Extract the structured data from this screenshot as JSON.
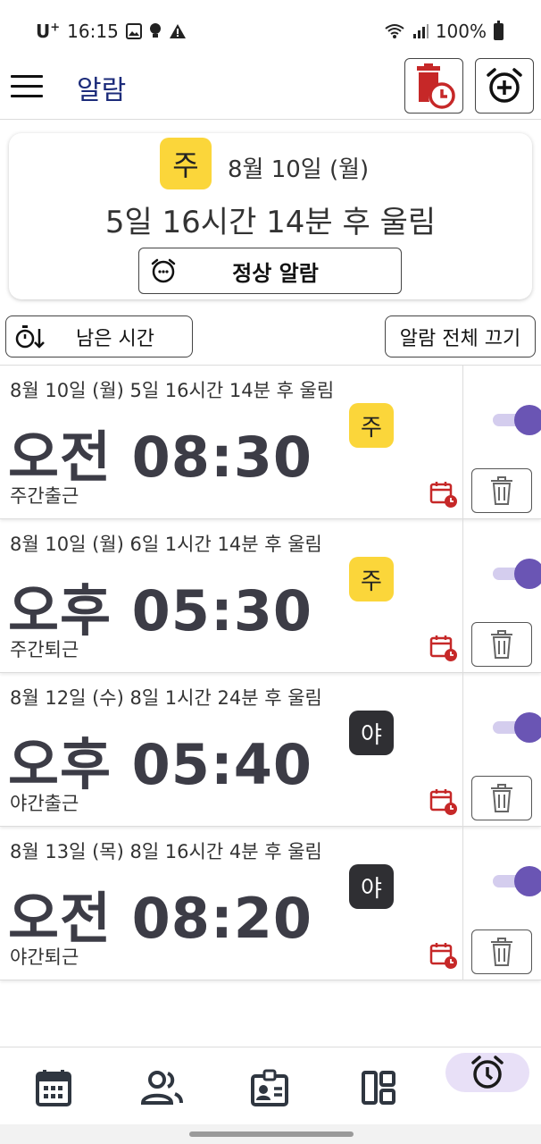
{
  "status_bar": {
    "carrier": "U",
    "carrier_sup": "+",
    "time": "16:15",
    "battery": "100%"
  },
  "app_bar": {
    "title": "알람"
  },
  "next_alarm": {
    "shift_badge": "주",
    "date": "8월 10일 (월)",
    "remaining": "5일 16시간 14분 후 울림",
    "mode_label": "정상 알람"
  },
  "controls": {
    "sort_label": "남은 시간",
    "all_off_label": "알람 전체 끄기"
  },
  "alarms": [
    {
      "next": "8월 10일 (월) 5일 16시간 14분 후 울림",
      "time": "오전 08:30",
      "name": "주간출근",
      "shift": "주",
      "shift_type": "day",
      "enabled": true
    },
    {
      "next": "8월 10일 (월) 6일 1시간 14분 후 울림",
      "time": "오후 05:30",
      "name": "주간퇴근",
      "shift": "주",
      "shift_type": "day",
      "enabled": true
    },
    {
      "next": "8월 12일 (수) 8일 1시간 24분 후 울림",
      "time": "오후 05:40",
      "name": "야간출근",
      "shift": "야",
      "shift_type": "night",
      "enabled": true
    },
    {
      "next": "8월 13일 (목) 8일 16시간 4분 후 울림",
      "time": "오전 08:20",
      "name": "야간퇴근",
      "shift": "야",
      "shift_type": "night",
      "enabled": true
    }
  ],
  "colors": {
    "day_badge": "#fbd63a",
    "night_badge": "#2f2f33",
    "accent": "#6a55b4",
    "toggle_track": "#d4cdee",
    "danger_red": "#c62828",
    "title_blue": "#1c2b7a",
    "nav_active_bg": "#e8e0f7"
  },
  "icons": {
    "top_history": "alarm-history-icon",
    "top_add": "add-alarm-icon",
    "mode": "alarm-face-icon",
    "sort": "sort-timer-icon",
    "schedule": "calendar-clock-icon",
    "delete": "trash-icon",
    "nav": [
      "calendar-icon",
      "people-icon",
      "id-badge-icon",
      "layout-icon",
      "alarm-clock-icon"
    ]
  }
}
